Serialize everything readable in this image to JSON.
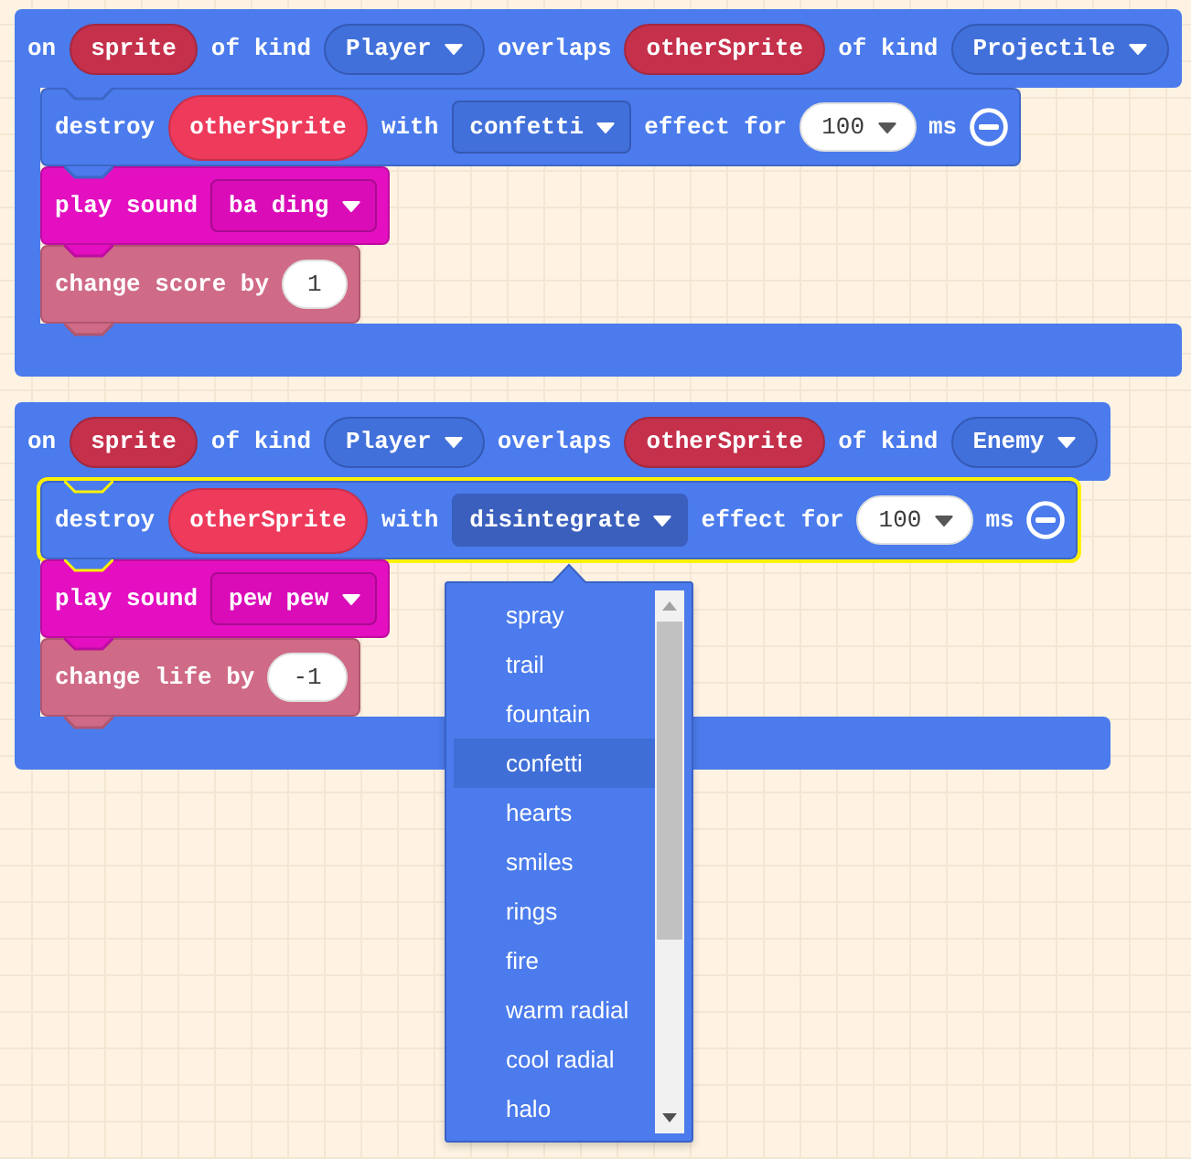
{
  "events": [
    {
      "kind": "sprites",
      "parts": [
        {
          "kind": "label",
          "text": "on"
        },
        {
          "kind": "parameter",
          "text": "sprite"
        },
        {
          "kind": "label",
          "text": "of kind"
        },
        {
          "kind": "enum",
          "text": "Player",
          "open": false
        },
        {
          "kind": "label",
          "text": "overlaps"
        },
        {
          "kind": "parameter",
          "text": "otherSprite"
        },
        {
          "kind": "label",
          "text": "of kind"
        },
        {
          "kind": "enum",
          "text": "Projectile",
          "open": false
        }
      ],
      "statements": [
        {
          "kind": "sprites",
          "selected": false,
          "parts": [
            {
              "kind": "label",
              "text": "destroy"
            },
            {
              "kind": "variable",
              "text": "otherSprite"
            },
            {
              "kind": "label",
              "text": "with"
            },
            {
              "kind": "dropdown",
              "text": "confetti",
              "open": false
            },
            {
              "kind": "label",
              "text": "effect for"
            },
            {
              "kind": "number_dropdown",
              "text": "100",
              "open": false
            },
            {
              "kind": "label",
              "text": "ms"
            },
            {
              "kind": "remove"
            }
          ]
        },
        {
          "kind": "music",
          "selected": false,
          "parts": [
            {
              "kind": "label",
              "text": "play sound"
            },
            {
              "kind": "dropdown",
              "text": "ba ding",
              "open": false
            }
          ]
        },
        {
          "kind": "info",
          "selected": false,
          "parts": [
            {
              "kind": "label",
              "text": "change score by"
            },
            {
              "kind": "number",
              "text": "1"
            }
          ]
        }
      ]
    },
    {
      "kind": "sprites",
      "parts": [
        {
          "kind": "label",
          "text": "on"
        },
        {
          "kind": "parameter",
          "text": "sprite"
        },
        {
          "kind": "label",
          "text": "of kind"
        },
        {
          "kind": "enum",
          "text": "Player",
          "open": false
        },
        {
          "kind": "label",
          "text": "overlaps"
        },
        {
          "kind": "parameter",
          "text": "otherSprite"
        },
        {
          "kind": "label",
          "text": "of kind"
        },
        {
          "kind": "enum",
          "text": "Enemy",
          "open": false
        }
      ],
      "statements": [
        {
          "kind": "sprites",
          "selected": true,
          "parts": [
            {
              "kind": "label",
              "text": "destroy"
            },
            {
              "kind": "variable",
              "text": "otherSprite"
            },
            {
              "kind": "label",
              "text": "with"
            },
            {
              "kind": "dropdown",
              "text": "disintegrate",
              "open": true,
              "menu": [
                {
                  "label": "spray",
                  "highlighted": false
                },
                {
                  "label": "trail",
                  "highlighted": false
                },
                {
                  "label": "fountain",
                  "highlighted": false
                },
                {
                  "label": "confetti",
                  "highlighted": true
                },
                {
                  "label": "hearts",
                  "highlighted": false
                },
                {
                  "label": "smiles",
                  "highlighted": false
                },
                {
                  "label": "rings",
                  "highlighted": false
                },
                {
                  "label": "fire",
                  "highlighted": false
                },
                {
                  "label": "warm radial",
                  "highlighted": false
                },
                {
                  "label": "cool radial",
                  "highlighted": false
                },
                {
                  "label": "halo",
                  "highlighted": false
                }
              ]
            },
            {
              "kind": "label",
              "text": "effect for"
            },
            {
              "kind": "number_dropdown",
              "text": "100",
              "open": false
            },
            {
              "kind": "label",
              "text": "ms"
            },
            {
              "kind": "remove"
            }
          ]
        },
        {
          "kind": "music",
          "selected": false,
          "parts": [
            {
              "kind": "label",
              "text": "play sound"
            },
            {
              "kind": "dropdown",
              "text": "pew pew",
              "open": false
            }
          ]
        },
        {
          "kind": "info",
          "selected": false,
          "parts": [
            {
              "kind": "label",
              "text": "change life by"
            },
            {
              "kind": "number",
              "text": "-1"
            }
          ]
        }
      ]
    }
  ]
}
